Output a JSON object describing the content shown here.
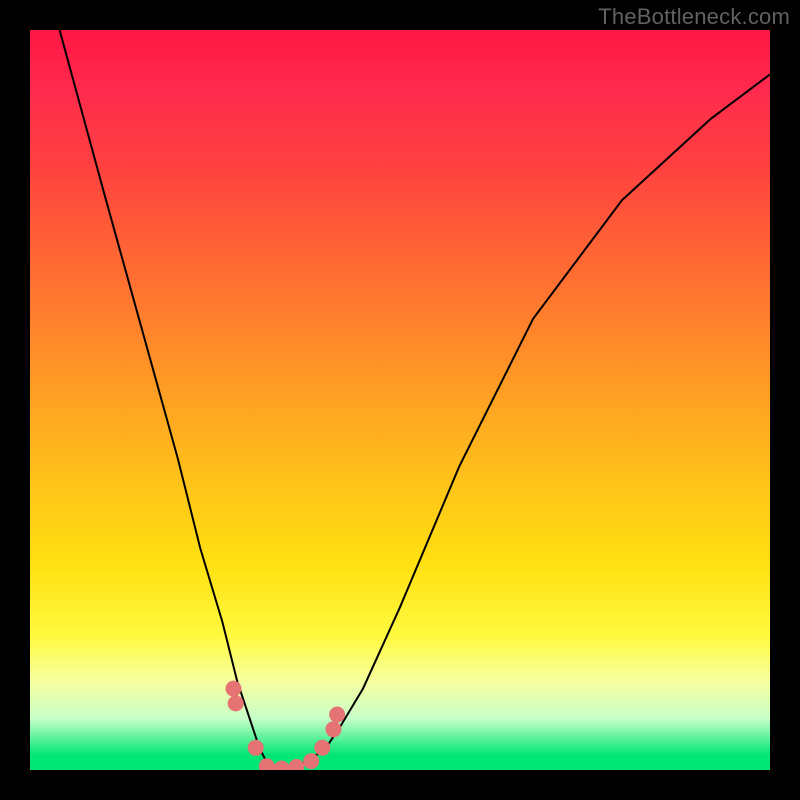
{
  "watermark": "TheBottleneck.com",
  "chart_data": {
    "type": "line",
    "title": "",
    "xlabel": "",
    "ylabel": "",
    "xlim": [
      0,
      100
    ],
    "ylim": [
      0,
      100
    ],
    "grid": false,
    "series": [
      {
        "name": "curve",
        "x": [
          4,
          10,
          15,
          20,
          23,
          26,
          28,
          30,
          31,
          32,
          33,
          34,
          36,
          38,
          40,
          42,
          45,
          50,
          58,
          68,
          80,
          92,
          100
        ],
        "y": [
          100,
          78,
          60,
          42,
          30,
          20,
          12,
          6,
          3,
          1,
          0,
          0,
          0.5,
          1.5,
          3,
          6,
          11,
          22,
          41,
          61,
          77,
          88,
          94
        ]
      }
    ],
    "markers": [
      {
        "x": 27.5,
        "y": 11
      },
      {
        "x": 27.8,
        "y": 9
      },
      {
        "x": 30.5,
        "y": 3
      },
      {
        "x": 32,
        "y": 0.5
      },
      {
        "x": 34,
        "y": 0.2
      },
      {
        "x": 36,
        "y": 0.4
      },
      {
        "x": 38,
        "y": 1.2
      },
      {
        "x": 39.5,
        "y": 3
      },
      {
        "x": 41,
        "y": 5.5
      },
      {
        "x": 41.5,
        "y": 7.5
      }
    ],
    "background_gradient": {
      "top": "#ff1744",
      "mid": "#ffeb3b",
      "bottom": "#00e676"
    }
  }
}
